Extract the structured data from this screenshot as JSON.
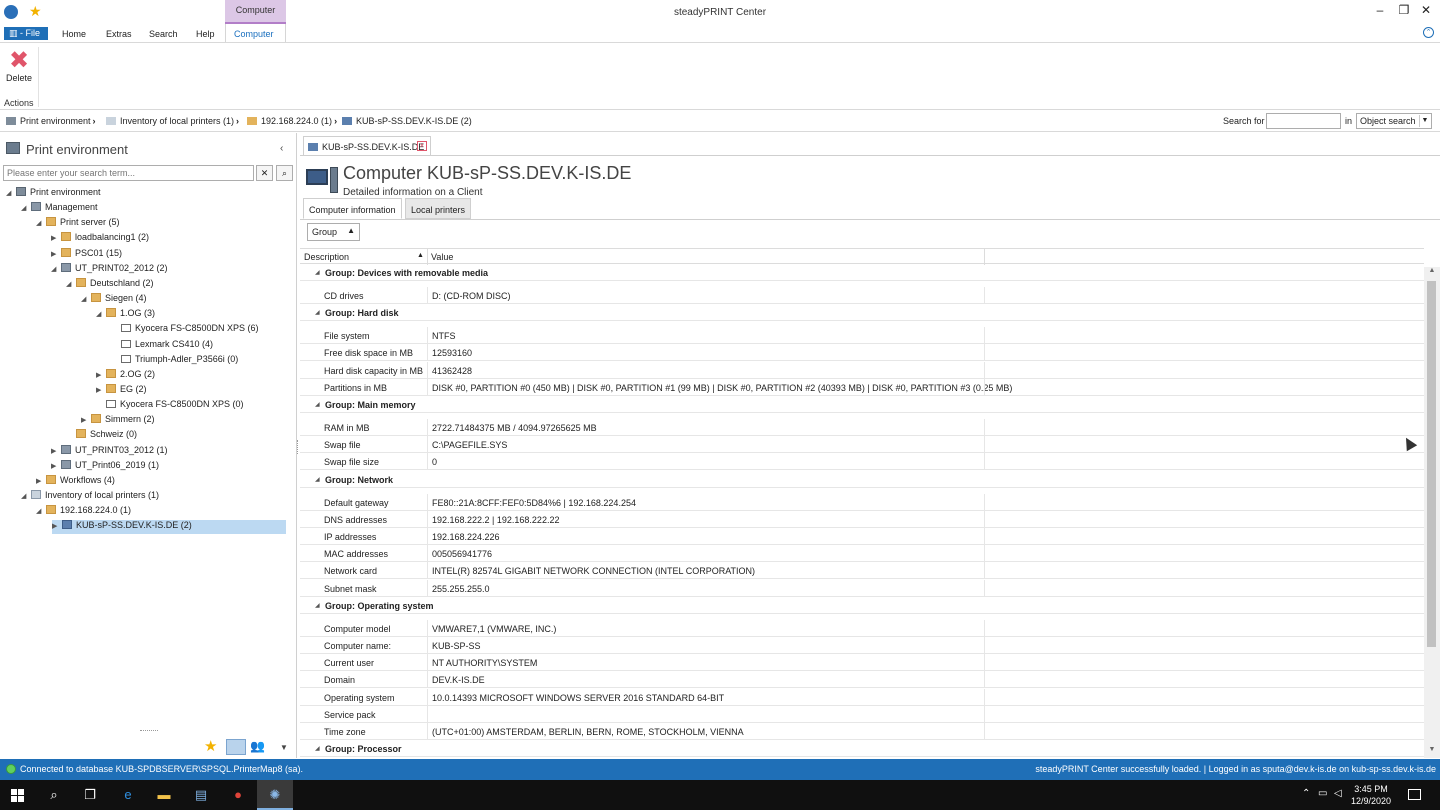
{
  "window": {
    "title": "steadyPRINT Center",
    "contextual_tab_header": "Computer",
    "minimize": "–",
    "restore": "❐",
    "close": "✕"
  },
  "ribbon": {
    "file_label": "File",
    "tabs": [
      "Home",
      "Extras",
      "Search",
      "Help",
      "Computer"
    ],
    "active_tab": "Computer",
    "delete_label": "Delete",
    "actions_group_label": "Actions"
  },
  "breadcrumb": {
    "items": [
      "Print environment",
      "Inventory of local printers (1)",
      "192.168.224.0 (1)",
      "KUB-sP-SS.DEV.K-IS.DE (2)"
    ],
    "search_for_label": "Search for",
    "in_label": "in",
    "search_scope": "Object search"
  },
  "left_panel": {
    "title": "Print environment",
    "search_placeholder": "Please enter your search term...",
    "tree": [
      {
        "label": "Print environment",
        "level": 0,
        "exp": "◢",
        "icon": "root"
      },
      {
        "label": "Management",
        "level": 1,
        "exp": "◢",
        "icon": "server"
      },
      {
        "label": "Print server (5)",
        "level": 2,
        "exp": "◢",
        "icon": "folder"
      },
      {
        "label": "loadbalancing1 (2)",
        "level": 3,
        "exp": "▶",
        "icon": "folder"
      },
      {
        "label": "PSC01 (15)",
        "level": 3,
        "exp": "▶",
        "icon": "folder"
      },
      {
        "label": "UT_PRINT02_2012 (2)",
        "level": 3,
        "exp": "◢",
        "icon": "server"
      },
      {
        "label": "Deutschland (2)",
        "level": 4,
        "exp": "◢",
        "icon": "folder"
      },
      {
        "label": "Siegen (4)",
        "level": 5,
        "exp": "◢",
        "icon": "folder"
      },
      {
        "label": "1.OG (3)",
        "level": 6,
        "exp": "◢",
        "icon": "folder"
      },
      {
        "label": "Kyocera FS-C8500DN XPS (6)",
        "level": 7,
        "exp": "",
        "icon": "printer"
      },
      {
        "label": "Lexmark CS410 (4)",
        "level": 7,
        "exp": "",
        "icon": "printer"
      },
      {
        "label": "Triumph-Adler_P3566i (0)",
        "level": 7,
        "exp": "",
        "icon": "printer"
      },
      {
        "label": "2.OG (2)",
        "level": 6,
        "exp": "▶",
        "icon": "folder"
      },
      {
        "label": "EG (2)",
        "level": 6,
        "exp": "▶",
        "icon": "folder"
      },
      {
        "label": "Kyocera FS-C8500DN XPS (0)",
        "level": 6,
        "exp": "",
        "icon": "printer"
      },
      {
        "label": "Simmern (2)",
        "level": 5,
        "exp": "▶",
        "icon": "folder"
      },
      {
        "label": "Schweiz (0)",
        "level": 4,
        "exp": "",
        "icon": "folder"
      },
      {
        "label": "UT_PRINT03_2012 (1)",
        "level": 3,
        "exp": "▶",
        "icon": "server"
      },
      {
        "label": "UT_Print06_2019 (1)",
        "level": 3,
        "exp": "▶",
        "icon": "server"
      },
      {
        "label": "Workflows (4)",
        "level": 2,
        "exp": "▶",
        "icon": "folder"
      },
      {
        "label": "Inventory of local printers (1)",
        "level": 1,
        "exp": "◢",
        "icon": "inv"
      },
      {
        "label": "192.168.224.0 (1)",
        "level": 2,
        "exp": "◢",
        "icon": "folder"
      },
      {
        "label": "KUB-sP-SS.DEV.K-IS.DE (2)",
        "level": 3,
        "exp": "▶",
        "icon": "computer",
        "selected": true
      }
    ]
  },
  "document": {
    "tab_label": "KUB-sP-SS.DEV.K-IS.DE",
    "title": "Computer KUB-sP-SS.DEV.K-IS.DE",
    "subtitle": "Detailed information on a Client",
    "subtabs": [
      "Computer information",
      "Local printers"
    ],
    "group_combo": "Group",
    "columns": [
      "Description",
      "Value"
    ],
    "rows": [
      {
        "group": "Group: Devices with removable media"
      },
      {
        "desc": "CD drives",
        "val": "D: (CD-ROM DISC)"
      },
      {
        "group": "Group: Hard disk"
      },
      {
        "desc": "File system",
        "val": "NTFS"
      },
      {
        "desc": "Free disk space in MB",
        "val": "12593160"
      },
      {
        "desc": "Hard disk capacity in MB",
        "val": "41362428"
      },
      {
        "desc": "Partitions in MB",
        "val": "DISK #0, PARTITION #0 (450 MB) | DISK #0, PARTITION #1 (99 MB) | DISK #0, PARTITION #2 (40393 MB) | DISK #0, PARTITION #3 (0.25 MB)"
      },
      {
        "group": "Group: Main memory"
      },
      {
        "desc": "RAM in MB",
        "val": "2722.71484375 MB / 4094.97265625 MB"
      },
      {
        "desc": "Swap file",
        "val": "C:\\PAGEFILE.SYS"
      },
      {
        "desc": "Swap file size",
        "val": "0"
      },
      {
        "group": "Group: Network"
      },
      {
        "desc": "Default gateway",
        "val": "FE80::21A:8CFF:FEF0:5D84%6 | 192.168.224.254"
      },
      {
        "desc": "DNS addresses",
        "val": "192.168.222.2 | 192.168.222.22"
      },
      {
        "desc": "IP addresses",
        "val": "192.168.224.226"
      },
      {
        "desc": "MAC addresses",
        "val": "005056941776"
      },
      {
        "desc": "Network card",
        "val": "INTEL(R) 82574L GIGABIT NETWORK CONNECTION (INTEL CORPORATION)"
      },
      {
        "desc": "Subnet mask",
        "val": "255.255.255.0"
      },
      {
        "group": "Group: Operating system"
      },
      {
        "desc": "Computer model",
        "val": "VMWARE7,1 (VMWARE, INC.)"
      },
      {
        "desc": "Computer name:",
        "val": "KUB-SP-SS"
      },
      {
        "desc": "Current user",
        "val": "NT AUTHORITY\\SYSTEM"
      },
      {
        "desc": "Domain",
        "val": "DEV.K-IS.DE"
      },
      {
        "desc": "Operating system",
        "val": "10.0.14393 MICROSOFT WINDOWS SERVER 2016 STANDARD 64-BIT"
      },
      {
        "desc": "Service pack",
        "val": ""
      },
      {
        "desc": "Time zone",
        "val": "(UTC+01:00) AMSTERDAM, BERLIN, BERN, ROME, STOCKHOLM, VIENNA"
      },
      {
        "group": "Group: Processor"
      }
    ]
  },
  "status": {
    "left": "Connected to database KUB-SPDBSERVER\\SPSQL.PrinterMap8 (sa).",
    "right": "steadyPRINT Center successfully loaded. | Logged in as sputa@dev.k-is.de on kub-sp-ss.dev.k-is.de"
  },
  "taskbar": {
    "time": "3:45 PM",
    "date": "12/9/2020"
  },
  "colors": {
    "accent": "#1f6fb7",
    "contextual": "#dcc7e6",
    "selection": "#bcd9f2",
    "delete": "#e0556a"
  }
}
